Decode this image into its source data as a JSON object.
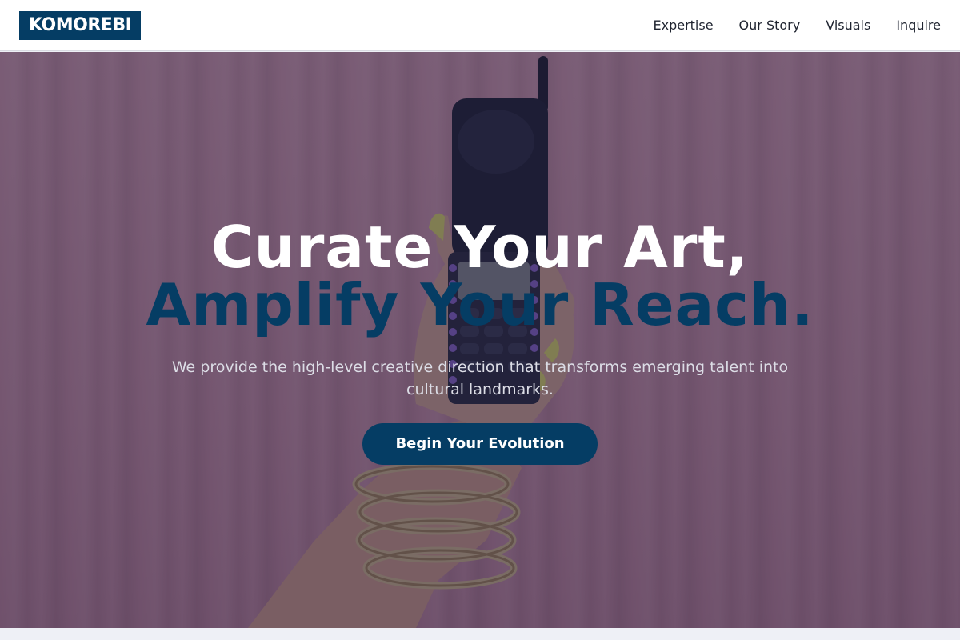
{
  "brand": {
    "name": "KOMOREBI"
  },
  "nav": {
    "items": [
      {
        "label": "Expertise"
      },
      {
        "label": "Our Story"
      },
      {
        "label": "Visuals"
      },
      {
        "label": "Inquire"
      }
    ]
  },
  "hero": {
    "headline_line1": "Curate Your Art,",
    "headline_line2": "Amplify Your Reach.",
    "subtitle": "We provide the high-level creative direction that transforms emerging talent into cultural landmarks.",
    "cta_label": "Begin Your Evolution",
    "background_icon": "hand-holding-flip-phone-image"
  },
  "colors": {
    "accent": "#053d64",
    "nav_background": "#ffffff",
    "overlay": "#1c183a",
    "curtain": "#d9a1b1"
  }
}
